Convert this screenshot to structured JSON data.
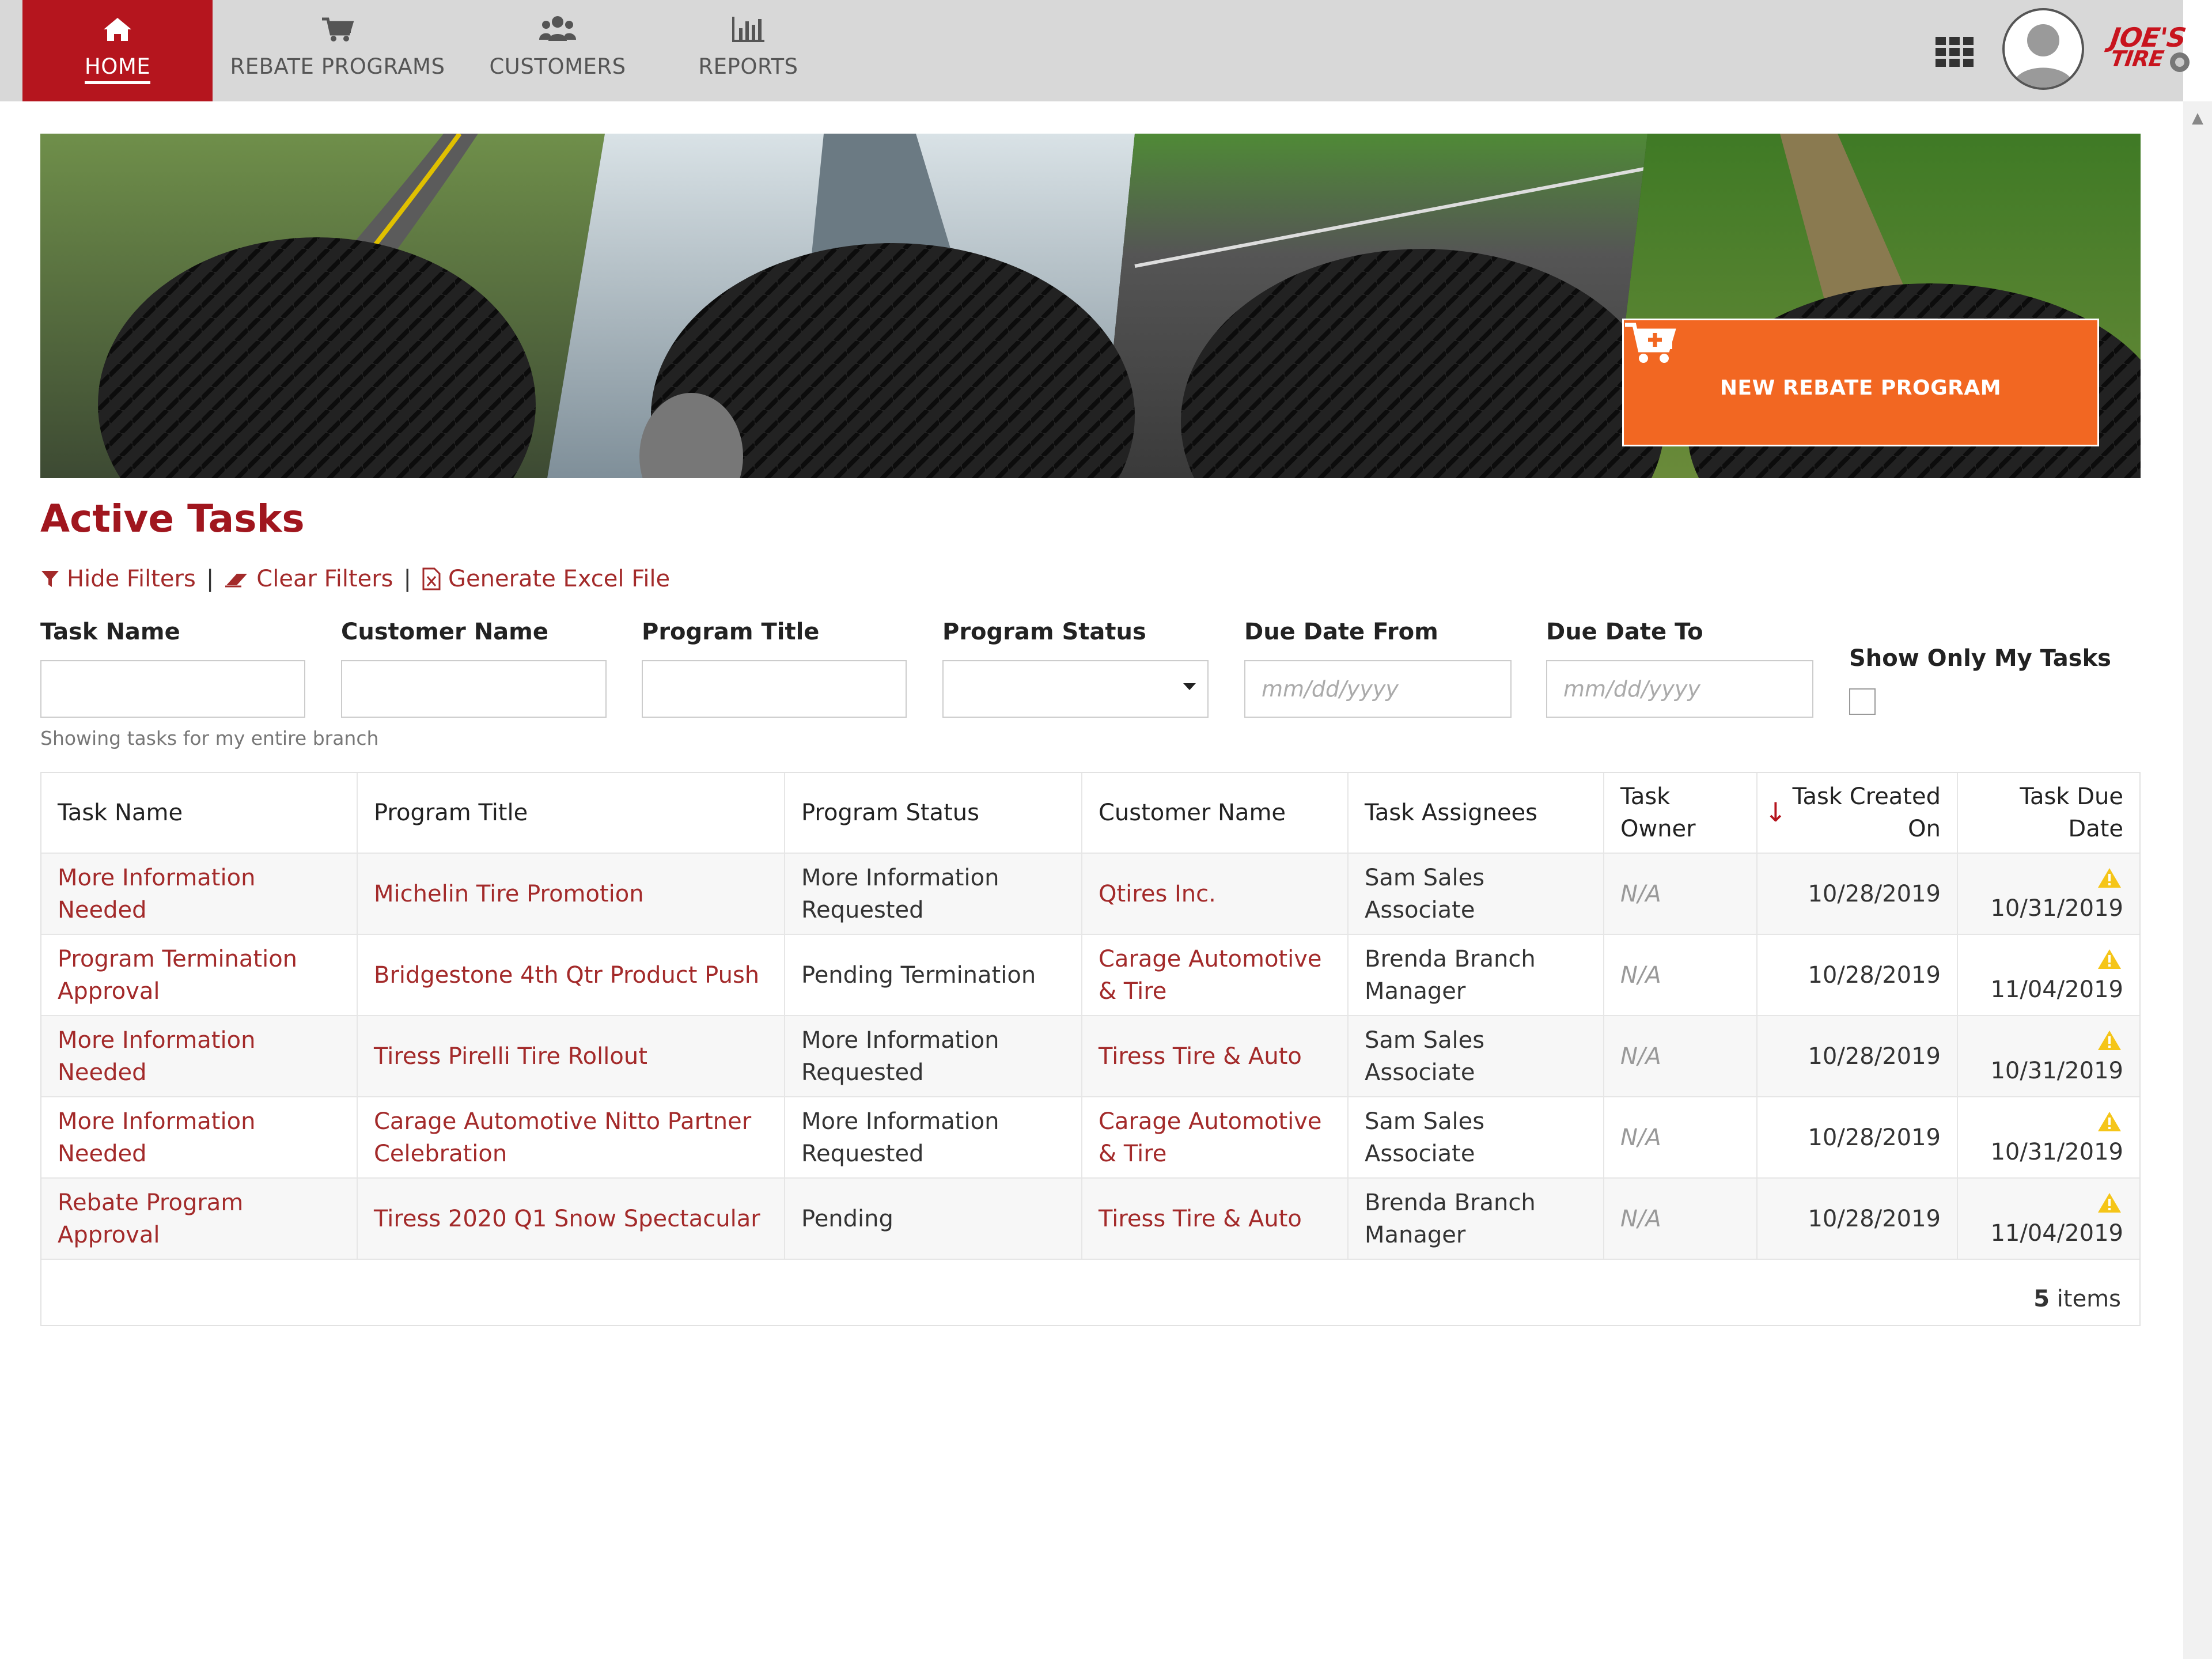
{
  "nav": {
    "items": [
      {
        "label": "HOME",
        "icon": "home-icon",
        "active": true
      },
      {
        "label": "REBATE PROGRAMS",
        "icon": "cart-icon",
        "active": false
      },
      {
        "label": "CUSTOMERS",
        "icon": "users-icon",
        "active": false
      },
      {
        "label": "REPORTS",
        "icon": "bar-chart-icon",
        "active": false
      }
    ],
    "brand": {
      "line1": "JOE'S",
      "line2": "TIRE"
    },
    "accent": "#b5151e"
  },
  "banner": {
    "button_label": "NEW REBATE PROGRAM",
    "button_icon": "cart-plus-icon",
    "button_color": "#f26722"
  },
  "tasks": {
    "title": "Active Tasks",
    "actions": {
      "hide_filters": "Hide Filters",
      "clear_filters": "Clear Filters",
      "generate_excel": "Generate Excel File",
      "separator": "|"
    },
    "filters": {
      "task_name": {
        "label": "Task Name",
        "value": ""
      },
      "customer_name": {
        "label": "Customer Name",
        "value": ""
      },
      "program_title": {
        "label": "Program Title",
        "value": ""
      },
      "program_status": {
        "label": "Program Status",
        "value": ""
      },
      "due_date_from": {
        "label": "Due Date From",
        "placeholder": "mm/dd/yyyy"
      },
      "due_date_to": {
        "label": "Due Date To",
        "placeholder": "mm/dd/yyyy"
      },
      "show_only_mine": {
        "label": "Show Only My Tasks",
        "checked": false
      }
    },
    "scope_note": "Showing tasks for my entire branch",
    "columns": {
      "task_name": "Task Name",
      "program_title": "Program Title",
      "program_status": "Program Status",
      "customer_name": "Customer Name",
      "assignees": "Task Assignees",
      "owner_l1": "Task",
      "owner_l2": "Owner",
      "created_l1": "Task Created",
      "created_l2": "On",
      "due_l1": "Task Due",
      "due_l2": "Date"
    },
    "rows": [
      {
        "task_l1": "More Information",
        "task_l2": "Needed",
        "program_l1": "Michelin Tire Promotion",
        "program_l2": "",
        "status_l1": "More Information",
        "status_l2": "Requested",
        "customer_l1": "Qtires Inc.",
        "customer_l2": "",
        "assignee_l1": "Sam Sales",
        "assignee_l2": "Associate",
        "owner": "N/A",
        "created": "10/28/2019",
        "due": "10/31/2019"
      },
      {
        "task_l1": "Program Termination",
        "task_l2": "Approval",
        "program_l1": "Bridgestone 4th Qtr Product Push",
        "program_l2": "",
        "status_l1": "Pending Termination",
        "status_l2": "",
        "customer_l1": "Carage Automotive",
        "customer_l2": "& Tire",
        "assignee_l1": "Brenda Branch",
        "assignee_l2": "Manager",
        "owner": "N/A",
        "created": "10/28/2019",
        "due": "11/04/2019"
      },
      {
        "task_l1": "More Information",
        "task_l2": "Needed",
        "program_l1": "Tiress Pirelli Tire Rollout",
        "program_l2": "",
        "status_l1": "More Information",
        "status_l2": "Requested",
        "customer_l1": "Tiress Tire & Auto",
        "customer_l2": "",
        "assignee_l1": "Sam Sales",
        "assignee_l2": "Associate",
        "owner": "N/A",
        "created": "10/28/2019",
        "due": "10/31/2019"
      },
      {
        "task_l1": "More Information",
        "task_l2": "Needed",
        "program_l1": "Carage Automotive Nitto Partner",
        "program_l2": "Celebration",
        "status_l1": "More Information",
        "status_l2": "Requested",
        "customer_l1": "Carage Automotive",
        "customer_l2": "& Tire",
        "assignee_l1": "Sam Sales",
        "assignee_l2": "Associate",
        "owner": "N/A",
        "created": "10/28/2019",
        "due": "10/31/2019"
      },
      {
        "task_l1": "Rebate Program",
        "task_l2": "Approval",
        "program_l1": "Tiress 2020 Q1 Snow Spectacular",
        "program_l2": "",
        "status_l1": "Pending",
        "status_l2": "",
        "customer_l1": "Tiress Tire & Auto",
        "customer_l2": "",
        "assignee_l1": "Brenda Branch",
        "assignee_l2": "Manager",
        "owner": "N/A",
        "created": "10/28/2019",
        "due": "11/04/2019"
      }
    ],
    "footer": {
      "count": "5",
      "count_label": " items"
    },
    "colors": {
      "link": "#a32a2a",
      "warning": "#f5c518"
    }
  }
}
